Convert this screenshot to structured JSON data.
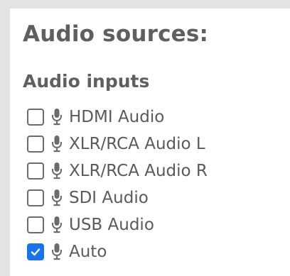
{
  "panel": {
    "title": "Audio sources:",
    "section_heading": "Audio inputs",
    "inputs": [
      {
        "label": "HDMI Audio",
        "checked": false,
        "icon": "microphone-icon"
      },
      {
        "label": "XLR/RCA Audio L",
        "checked": false,
        "icon": "microphone-icon"
      },
      {
        "label": "XLR/RCA Audio R",
        "checked": false,
        "icon": "microphone-icon"
      },
      {
        "label": "SDI Audio",
        "checked": false,
        "icon": "microphone-icon"
      },
      {
        "label": "USB Audio",
        "checked": false,
        "icon": "microphone-icon"
      },
      {
        "label": "Auto",
        "checked": true,
        "icon": "microphone-icon"
      }
    ]
  },
  "colors": {
    "background": "#e3e3e3",
    "panel": "#ffffff",
    "text": "#5f5f5f",
    "checkbox_checked": "#1a73e8",
    "checkbox_border": "#6b6b6b"
  }
}
